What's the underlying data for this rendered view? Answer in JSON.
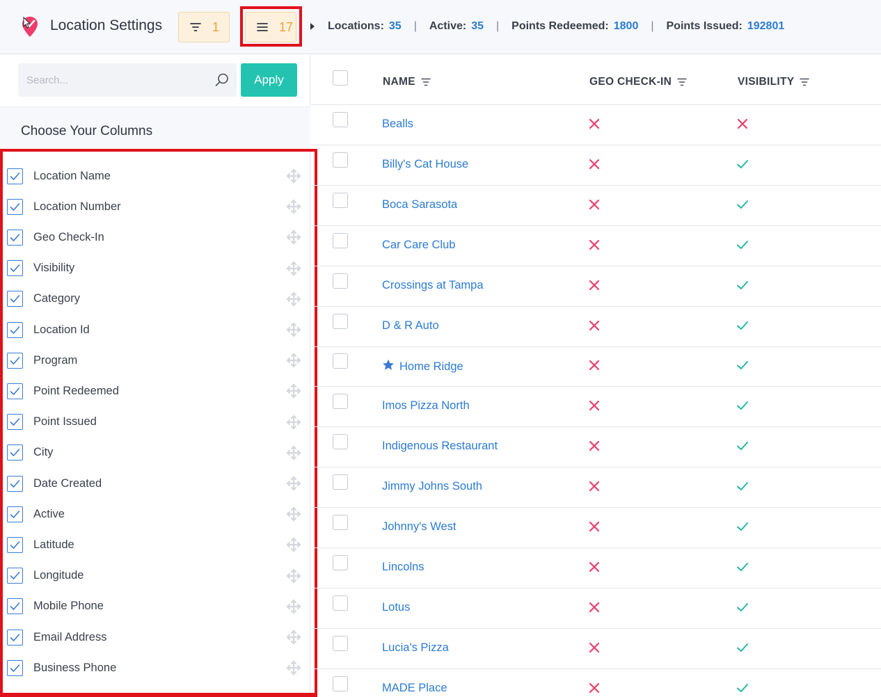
{
  "header": {
    "title": "Location Settings",
    "filter_count": "1",
    "columns_count": "17",
    "stats": [
      {
        "label": "Locations:",
        "value": "35"
      },
      {
        "label": "Active:",
        "value": "35"
      },
      {
        "label": "Points Redeemed:",
        "value": "1800"
      },
      {
        "label": "Points Issued:",
        "value": "192801"
      }
    ],
    "separator": "|"
  },
  "sidebar": {
    "search_placeholder": "Search...",
    "apply_label": "Apply",
    "choose_title": "Choose Your Columns",
    "columns": [
      "Location Name",
      "Location Number",
      "Geo Check-In",
      "Visibility",
      "Category",
      "Location Id",
      "Program",
      "Point Redeemed",
      "Point Issued",
      "City",
      "Date Created",
      "Active",
      "Latitude",
      "Longitude",
      "Mobile Phone",
      "Email Address",
      "Business Phone"
    ]
  },
  "table": {
    "headers": {
      "name": "NAME",
      "geo": "GEO CHECK-IN",
      "visibility": "VISIBILITY"
    },
    "rows": [
      {
        "name": "Bealls",
        "geo": "no",
        "visibility": "no",
        "starred": false
      },
      {
        "name": "Billy's Cat House",
        "geo": "no",
        "visibility": "yes",
        "starred": false
      },
      {
        "name": "Boca Sarasota",
        "geo": "no",
        "visibility": "yes",
        "starred": false
      },
      {
        "name": "Car Care Club",
        "geo": "no",
        "visibility": "yes",
        "starred": false
      },
      {
        "name": "Crossings at Tampa",
        "geo": "no",
        "visibility": "yes",
        "starred": false
      },
      {
        "name": "D & R Auto",
        "geo": "no",
        "visibility": "yes",
        "starred": false
      },
      {
        "name": "Home Ridge",
        "geo": "no",
        "visibility": "yes",
        "starred": true
      },
      {
        "name": "Imos Pizza North",
        "geo": "no",
        "visibility": "yes",
        "starred": false
      },
      {
        "name": "Indigenous Restaurant",
        "geo": "no",
        "visibility": "yes",
        "starred": false
      },
      {
        "name": "Jimmy Johns South",
        "geo": "no",
        "visibility": "yes",
        "starred": false
      },
      {
        "name": "Johnny's West",
        "geo": "no",
        "visibility": "yes",
        "starred": false
      },
      {
        "name": "Lincolns",
        "geo": "no",
        "visibility": "yes",
        "starred": false
      },
      {
        "name": "Lotus",
        "geo": "no",
        "visibility": "yes",
        "starred": false
      },
      {
        "name": "Lucia's Pizza",
        "geo": "no",
        "visibility": "yes",
        "starred": false
      },
      {
        "name": "MADE Place",
        "geo": "no",
        "visibility": "yes",
        "starred": false
      }
    ]
  },
  "colors": {
    "accent": "#2b7bd3",
    "apply": "#23c3b0",
    "cross": "#ee3d6a",
    "check": "#23b8a6",
    "highlight": "#e0111b",
    "badge": "#f0a032"
  }
}
